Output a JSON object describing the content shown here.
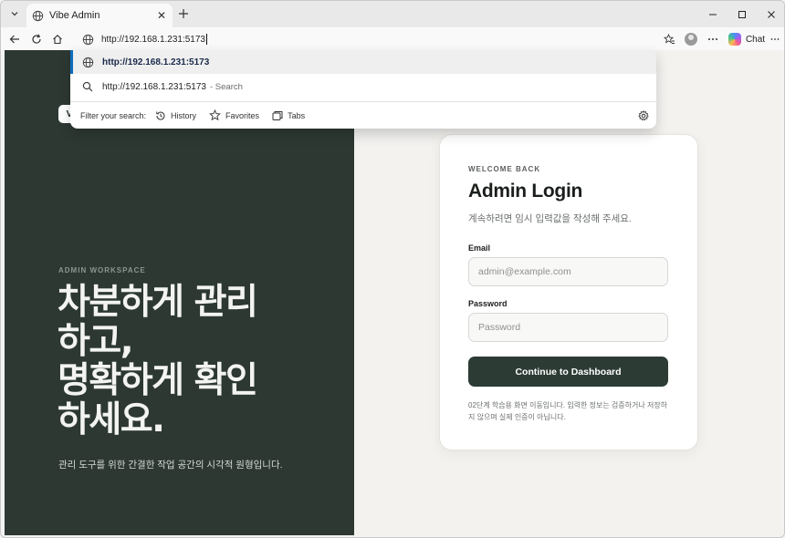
{
  "browser": {
    "tab": {
      "title": "Vibe Admin"
    },
    "address": {
      "url": "http://192.168.1.231:5173"
    },
    "chat_label": "Chat",
    "dropdown": {
      "suggestions": [
        {
          "text": "http://192.168.1.231:5173",
          "hint": ""
        },
        {
          "text": "http://192.168.1.231:5173",
          "hint": "- Search"
        }
      ],
      "filter_label": "Filter your search:",
      "filters": [
        "History",
        "Favorites",
        "Tabs"
      ]
    }
  },
  "hero": {
    "brand": "V",
    "kicker": "ADMIN WORKSPACE",
    "title_lines": [
      "차분하게 관리",
      "하고,",
      "명확하게 확인",
      "하세요."
    ],
    "subtitle": "관리 도구를 위한 간결한 작업 공간의 시각적 원형입니다."
  },
  "login": {
    "kicker": "WELCOME BACK",
    "heading": "Admin Login",
    "description": "계속하려면 임시 입력값을 작성해 주세요.",
    "email_label": "Email",
    "email_placeholder": "admin@example.com",
    "password_label": "Password",
    "password_placeholder": "Password",
    "submit_label": "Continue to Dashboard",
    "notice": "02단계 학습용 화면 이동입니다. 입력한 정보는 검증하거나 저장하지 않으며 실제 인증이 아닙니다."
  }
}
